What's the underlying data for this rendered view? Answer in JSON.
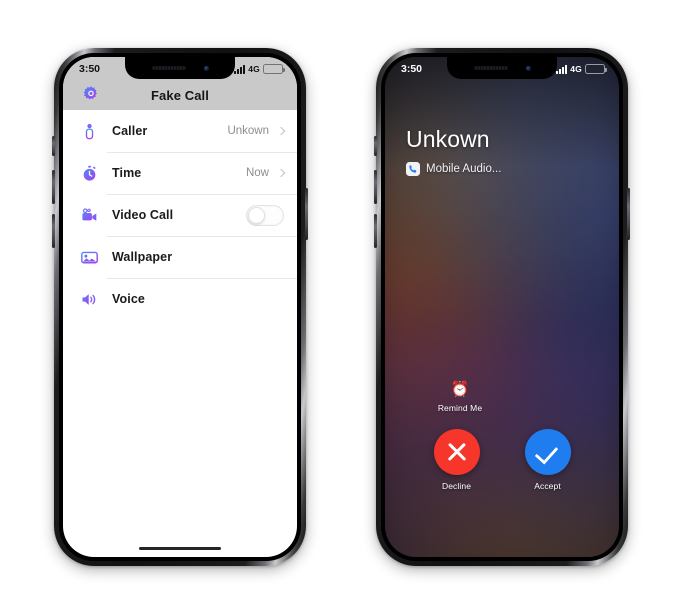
{
  "colors": {
    "accent_blue": "#1f7df0",
    "decline_red": "#f6352b",
    "battery_yellow": "#f5c518",
    "icon_gradient_start": "#4d8cf5",
    "icon_gradient_end": "#a83df0",
    "navbar_gray": "#c9c9c9"
  },
  "left_phone": {
    "status_bar": {
      "time": "3:50",
      "signal_icon": "signal-bars-icon",
      "network": "4G",
      "battery_icon": "battery-icon",
      "battery_level_pct": 40
    },
    "nav": {
      "gear_icon": "gear-icon",
      "title": "Fake Call"
    },
    "rows": [
      {
        "icon": "person-icon",
        "label": "Caller",
        "value": "Unkown",
        "control": "chevron"
      },
      {
        "icon": "stopwatch-icon",
        "label": "Time",
        "value": "Now",
        "control": "chevron"
      },
      {
        "icon": "video-camera-icon",
        "label": "Video Call",
        "value": "",
        "control": "toggle",
        "toggle_on": false
      },
      {
        "icon": "photo-icon",
        "label": "Wallpaper",
        "value": "",
        "control": "none"
      },
      {
        "icon": "speaker-icon",
        "label": "Voice",
        "value": "",
        "control": "none"
      }
    ],
    "home_indicator": "home-indicator"
  },
  "right_phone": {
    "status_bar": {
      "time": "3:50",
      "signal_icon": "signal-bars-icon",
      "network": "4G",
      "battery_icon": "battery-icon",
      "battery_level_pct": 40
    },
    "call": {
      "caller_name": "Unkown",
      "audio_icon": "phone-handset-icon",
      "audio_label": "Mobile Audio...",
      "remind": {
        "icon": "alarm-clock-icon",
        "glyph": "⏰",
        "label": "Remind Me"
      },
      "decline": {
        "icon": "x-icon",
        "label": "Decline"
      },
      "accept": {
        "icon": "check-icon",
        "label": "Accept"
      }
    }
  }
}
